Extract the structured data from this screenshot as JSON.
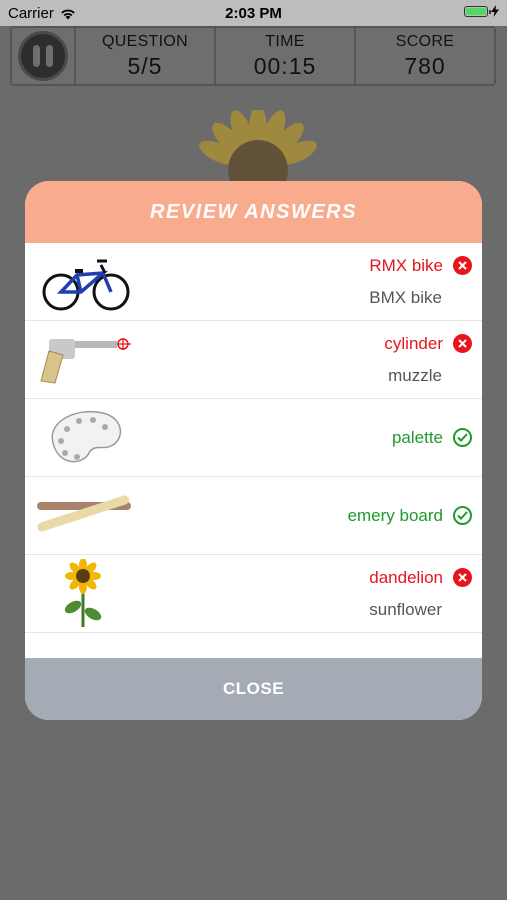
{
  "status_bar": {
    "carrier": "Carrier",
    "time": "2:03 PM"
  },
  "hud": {
    "question_label": "QUESTION",
    "question_value": "5/5",
    "time_label": "TIME",
    "time_value": "00:15",
    "score_label": "SCORE",
    "score_value": "780"
  },
  "modal": {
    "title": "REVIEW ANSWERS",
    "close_label": "CLOSE",
    "rows": [
      {
        "given": "RMX bike",
        "correct": "BMX bike",
        "result": "wrong",
        "image": "bicycle"
      },
      {
        "given": "cylinder",
        "correct": "muzzle",
        "result": "wrong",
        "image": "revolver"
      },
      {
        "given": "palette",
        "correct": "",
        "result": "right",
        "image": "palette"
      },
      {
        "given": "emery board",
        "correct": "",
        "result": "right",
        "image": "emery-board"
      },
      {
        "given": "dandelion",
        "correct": "sunflower",
        "result": "wrong",
        "image": "sunflower"
      }
    ]
  },
  "colors": {
    "header": "#f9ab8e",
    "wrong": "#e8141c",
    "right": "#1e9b2c",
    "close": "#a5abb5"
  }
}
